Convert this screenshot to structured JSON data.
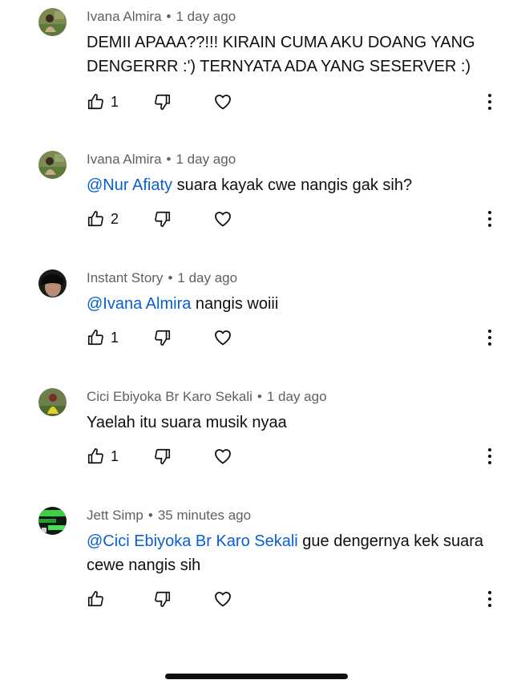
{
  "comments": [
    {
      "author": "Ivana Almira",
      "time": "1 day ago",
      "mention": "",
      "text": "DEMII APAAA??!!! KIRAIN CUMA AKU DOANG YANG DENGERRR :') TERNYATA ADA YANG SESERVER :)",
      "likes": "1",
      "avatar": "nature-photo"
    },
    {
      "author": "Ivana Almira",
      "time": "1 day ago",
      "mention": "@Nur Afiaty",
      "text": " suara kayak cwe nangis gak sih?",
      "likes": "2",
      "avatar": "nature-photo"
    },
    {
      "author": "Instant Story",
      "time": "1 day ago",
      "mention": "@Ivana Almira",
      "text": " nangis woiii",
      "likes": "1",
      "avatar": "dark-face-photo"
    },
    {
      "author": "Cici Ebiyoka Br Karo Sekali",
      "time": "1 day ago",
      "mention": "",
      "text": "Yaelah itu suara musik nyaa",
      "likes": "1",
      "avatar": "yellow-figure-photo"
    },
    {
      "author": "Jett Simp",
      "time": "35 minutes ago",
      "mention": "@Cici Ebiyoka Br Karo Sekali",
      "text": " gue dengernya kek suara cewe nangis sih",
      "likes": "",
      "avatar": "green-game-photo"
    }
  ],
  "separator": "•",
  "icons": {
    "like": "thumb-up-icon",
    "dislike": "thumb-down-icon",
    "heart": "heart-icon",
    "more": "more-vert-icon"
  },
  "colors": {
    "text": "#0f0f0f",
    "meta": "#606060",
    "mention": "#065fd4"
  }
}
